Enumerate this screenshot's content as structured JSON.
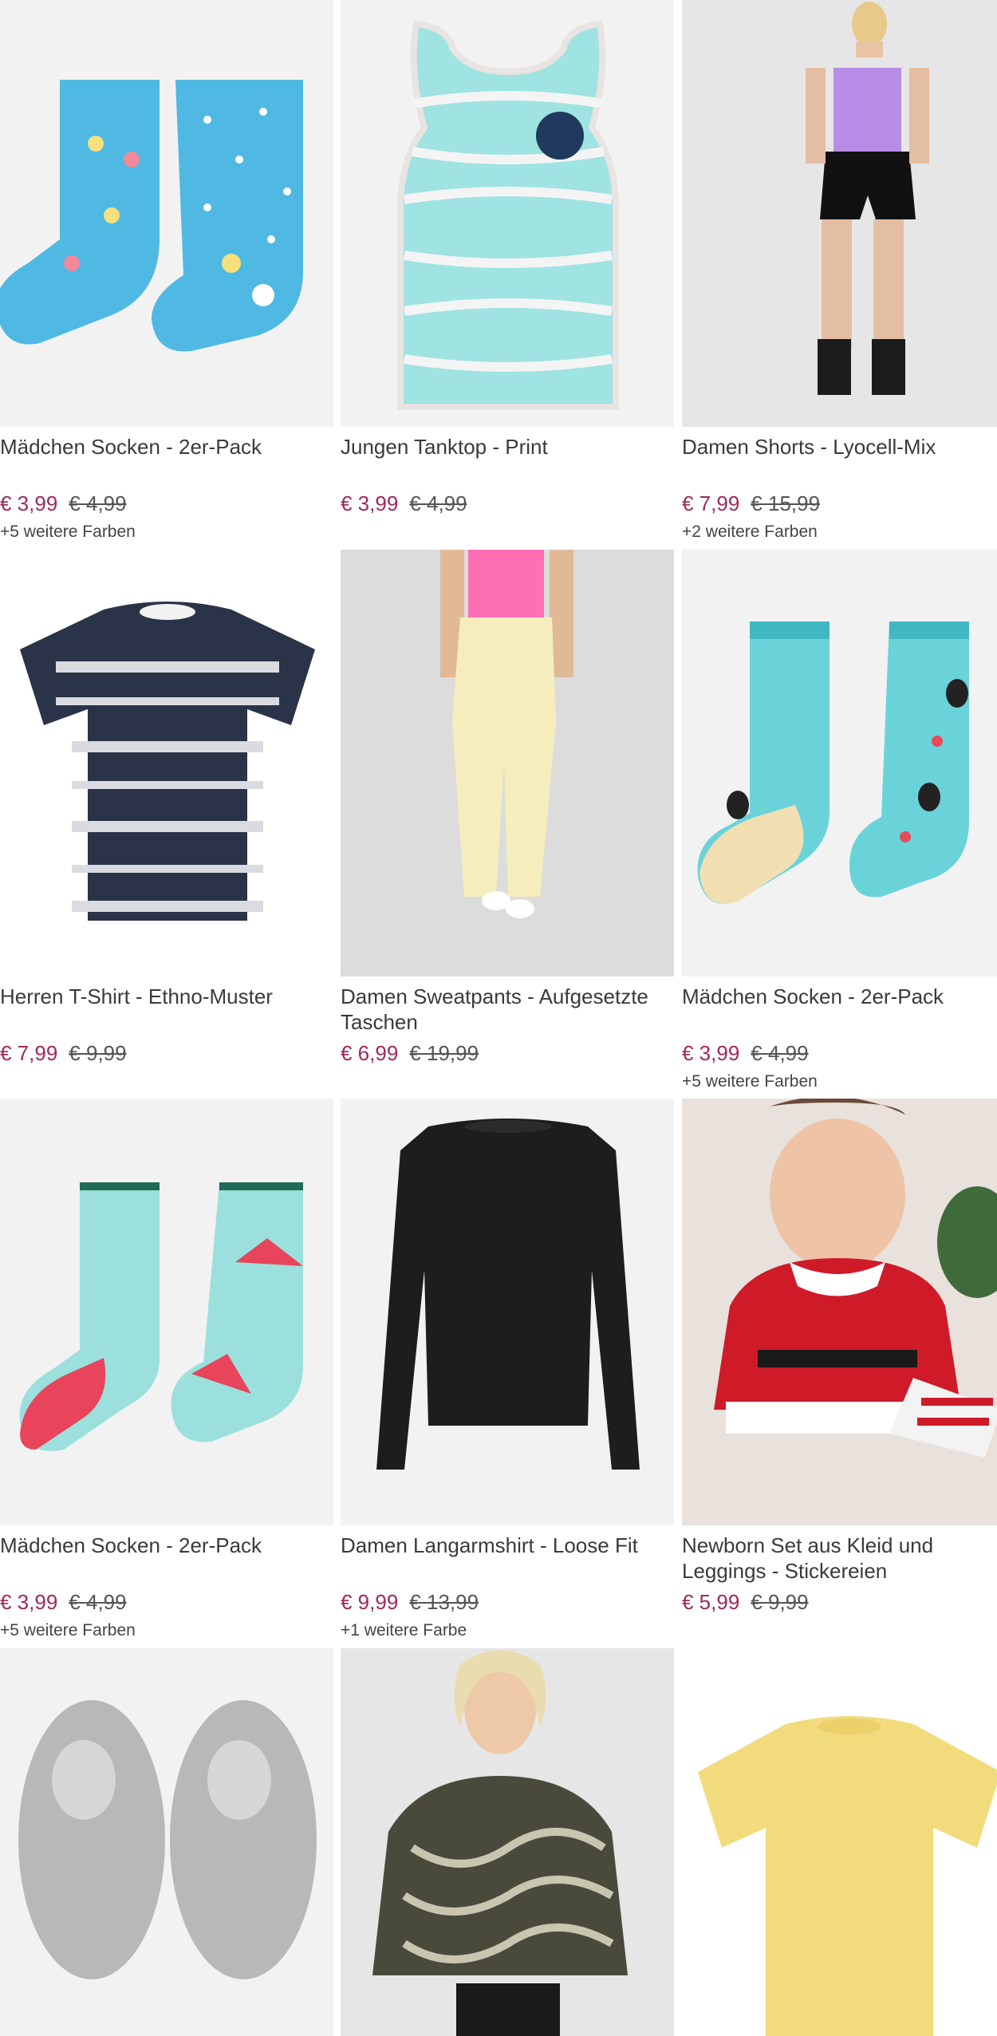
{
  "products": [
    {
      "title": "Mädchen Socken - 2er-Pack",
      "price": "€ 3,99",
      "old_price": "€ 4,99",
      "colors": "+5 weitere Farben"
    },
    {
      "title": "Jungen Tanktop - Print",
      "price": "€ 3,99",
      "old_price": "€ 4,99",
      "colors": ""
    },
    {
      "title": "Damen Shorts - Lyocell-Mix",
      "price": "€ 7,99",
      "old_price": "€ 15,99",
      "colors": "+2 weitere Farben"
    },
    {
      "title": "Herren T-Shirt - Ethno-Muster",
      "price": "€ 7,99",
      "old_price": "€ 9,99",
      "colors": ""
    },
    {
      "title": "Damen Sweatpants - Aufgesetzte Taschen",
      "price": "€ 6,99",
      "old_price": "€ 19,99",
      "colors": ""
    },
    {
      "title": "Mädchen Socken - 2er-Pack",
      "price": "€ 3,99",
      "old_price": "€ 4,99",
      "colors": "+5 weitere Farben"
    },
    {
      "title": "Mädchen Socken - 2er-Pack",
      "price": "€ 3,99",
      "old_price": "€ 4,99",
      "colors": "+5 weitere Farben"
    },
    {
      "title": "Damen Langarmshirt - Loose Fit",
      "price": "€ 9,99",
      "old_price": "€ 13,99",
      "colors": "+1 weitere Farbe"
    },
    {
      "title": "Newborn Set aus Kleid und Leggings - Stickereien",
      "price": "€ 5,99",
      "old_price": "€ 9,99",
      "colors": ""
    }
  ],
  "colors": {
    "price": "#a0295a",
    "text": "#3a3a3a",
    "image_bg": "#f2f2f2"
  }
}
